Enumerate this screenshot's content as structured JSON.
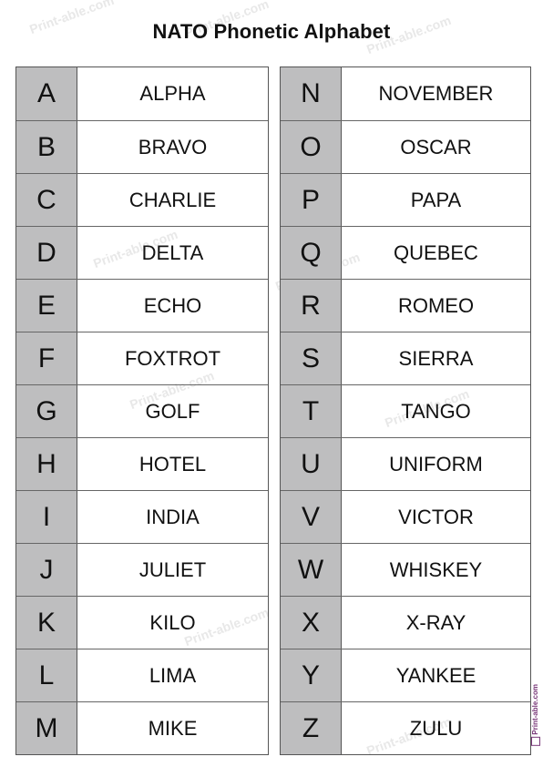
{
  "title": "NATO Phonetic Alphabet",
  "left_table": [
    {
      "letter": "A",
      "word": "ALPHA"
    },
    {
      "letter": "B",
      "word": "BRAVO"
    },
    {
      "letter": "C",
      "word": "CHARLIE"
    },
    {
      "letter": "D",
      "word": "DELTA"
    },
    {
      "letter": "E",
      "word": "ECHO"
    },
    {
      "letter": "F",
      "word": "FOXTROT"
    },
    {
      "letter": "G",
      "word": "GOLF"
    },
    {
      "letter": "H",
      "word": "HOTEL"
    },
    {
      "letter": "I",
      "word": "INDIA"
    },
    {
      "letter": "J",
      "word": "JULIET"
    },
    {
      "letter": "K",
      "word": "KILO"
    },
    {
      "letter": "L",
      "word": "LIMA"
    },
    {
      "letter": "M",
      "word": "MIKE"
    }
  ],
  "right_table": [
    {
      "letter": "N",
      "word": "NOVEMBER"
    },
    {
      "letter": "O",
      "word": "OSCAR"
    },
    {
      "letter": "P",
      "word": "PAPA"
    },
    {
      "letter": "Q",
      "word": "QUEBEC"
    },
    {
      "letter": "R",
      "word": "ROMEO"
    },
    {
      "letter": "S",
      "word": "SIERRA"
    },
    {
      "letter": "T",
      "word": "TANGO"
    },
    {
      "letter": "U",
      "word": "UNIFORM"
    },
    {
      "letter": "V",
      "word": "VICTOR"
    },
    {
      "letter": "W",
      "word": "WHISKEY"
    },
    {
      "letter": "X",
      "word": "X-RAY"
    },
    {
      "letter": "Y",
      "word": "YANKEE"
    },
    {
      "letter": "Z",
      "word": "ZULU"
    }
  ],
  "watermark": {
    "text": "Print-able.com",
    "side_text": "Print-able.com",
    "icon": "printer-icon"
  },
  "colors": {
    "letter_cell_bg": "#bebebf",
    "border": "#555555",
    "text": "#111111",
    "side_watermark": "#7a3a7a"
  }
}
